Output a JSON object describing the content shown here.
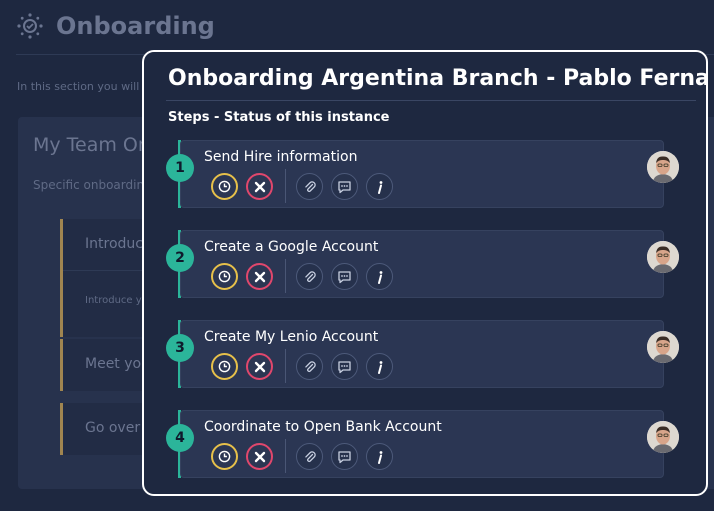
{
  "background": {
    "title": "Onboarding",
    "intro": "In this section you will find",
    "card_title": "My Team Onb",
    "card_subtitle": "Specific onboarding s",
    "items": [
      {
        "label": "Introduce",
        "sub": "Introduce you"
      },
      {
        "label": "Meet your",
        "sub": ""
      },
      {
        "label": "Go over th",
        "sub": ""
      }
    ]
  },
  "modal": {
    "title": "Onboarding Argentina Branch - Pablo Fernandez",
    "subtitle": "Steps - Status of this instance",
    "steps": [
      {
        "number": "1",
        "title": "Send Hire information"
      },
      {
        "number": "2",
        "title": "Create a Google Account"
      },
      {
        "number": "3",
        "title": "Create My Lenio Account"
      },
      {
        "number": "4",
        "title": "Coordinate to Open Bank Account"
      }
    ]
  },
  "colors": {
    "accent": "#2bb59a",
    "pending": "#e6c04a",
    "cancel": "#e0476c",
    "background": "#1e2840",
    "card": "#2b3653"
  },
  "icons": {
    "header": "onboarding-icon",
    "step_actions": [
      "clock-icon",
      "close-icon",
      "paperclip-icon",
      "comment-icon",
      "info-icon"
    ]
  }
}
